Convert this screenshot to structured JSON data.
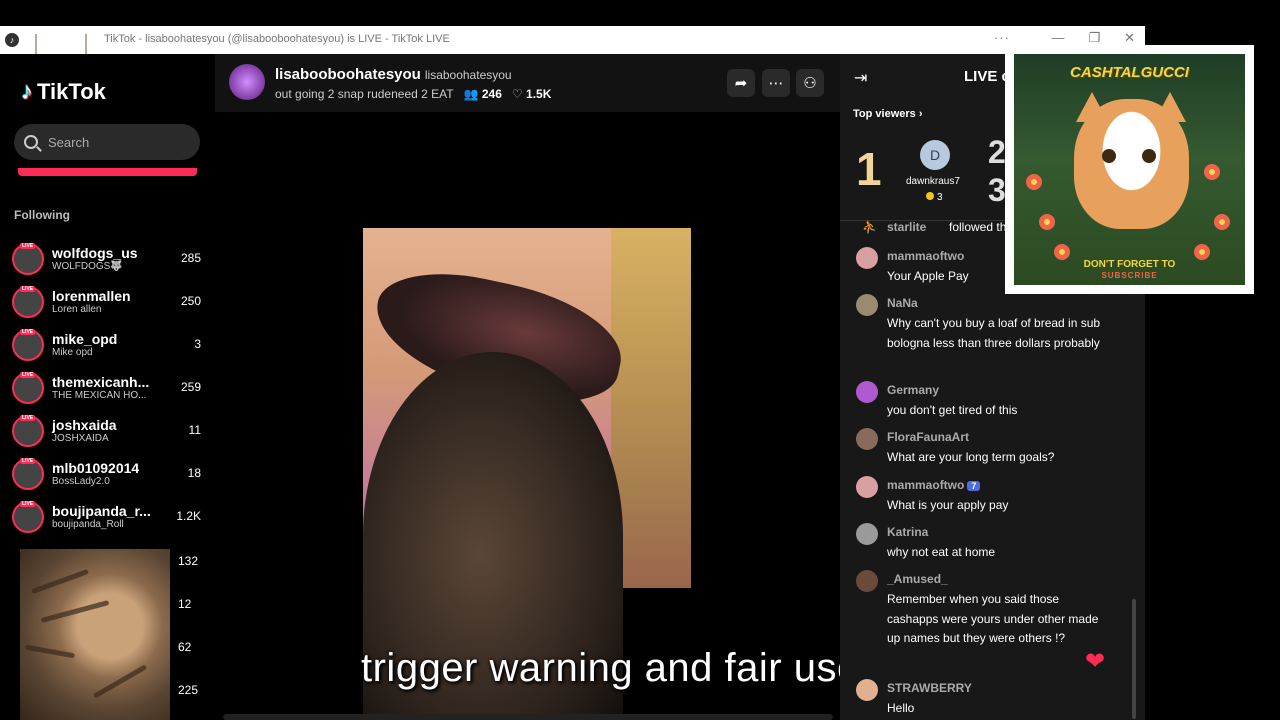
{
  "window": {
    "title": "TikTok - lisaboohatesyou (@lisabooboohatesyou) is LIVE - TikTok LIVE",
    "menu_dots": "···",
    "min": "—",
    "max": "❐",
    "close": "✕"
  },
  "sidebar": {
    "logo_text": "TikTok",
    "search_placeholder": "Search",
    "following_heading": "Following",
    "live_badge": "LIVE",
    "items": [
      {
        "username": "wolfdogs_us",
        "display": "WOLFDOGS🐺",
        "count": "285"
      },
      {
        "username": "lorenmallen",
        "display": "Loren allen",
        "count": "250"
      },
      {
        "username": "mike_opd",
        "display": "Mike opd",
        "count": "3"
      },
      {
        "username": "themexicanh...",
        "display": "THE MEXICAN HO...",
        "count": "259"
      },
      {
        "username": "joshxaida",
        "display": "JOSHXAIDA",
        "count": "11"
      },
      {
        "username": "mlb01092014",
        "display": "BossLady2.0",
        "count": "18"
      },
      {
        "username": "boujipanda_r...",
        "display": "boujipanda_Roll",
        "count": "1.2K"
      }
    ],
    "extra_counts": [
      "132",
      "12",
      "62",
      "225"
    ]
  },
  "stream": {
    "username": "lisabooboohatesyou",
    "handle": "lisaboohatesyou",
    "title": "out going 2 snap rudeneed 2 EAT",
    "viewers": "246",
    "likes": "1.5K"
  },
  "caption": "trigger warning and fair use",
  "chat": {
    "live_label": "LIVE c",
    "top_viewers_label": "Top viewers",
    "rank1": "1",
    "rank2": "2",
    "rank3": "3",
    "top_viewer": {
      "initial": "D",
      "name": "dawnkraus7",
      "coins": "3"
    },
    "follow_event": {
      "name": "starlite",
      "text": "followed the"
    },
    "messages": [
      {
        "name": "mammaoftwo",
        "text": "Your Apple Pay"
      },
      {
        "name": "NaNa",
        "text": "Why can't you buy a loaf of bread in sub bologna less than three dollars probably"
      },
      {
        "name": "Germany",
        "text": "you don't get tired of this"
      },
      {
        "name": "FloraFaunaArt",
        "text": "What are your long term goals?"
      },
      {
        "name": "mammaoftwo",
        "badge": "7",
        "text": "What is your apply pay"
      },
      {
        "name": "Katrina",
        "text": "why not eat at home"
      },
      {
        "name": "_Amused_",
        "text": "Remember when you said those cashapps were yours under other made up names but they were others !?"
      },
      {
        "name": "STRAWBERRY",
        "text": "Hello"
      }
    ]
  },
  "promo": {
    "brand": "CASHTALGUCCI",
    "cta_line1": "DON'T FORGET TO",
    "cta_line2": "SUBSCRIBE"
  },
  "colors": {
    "accent": "#fe2c55",
    "panel": "#181818",
    "header": "#121212"
  }
}
